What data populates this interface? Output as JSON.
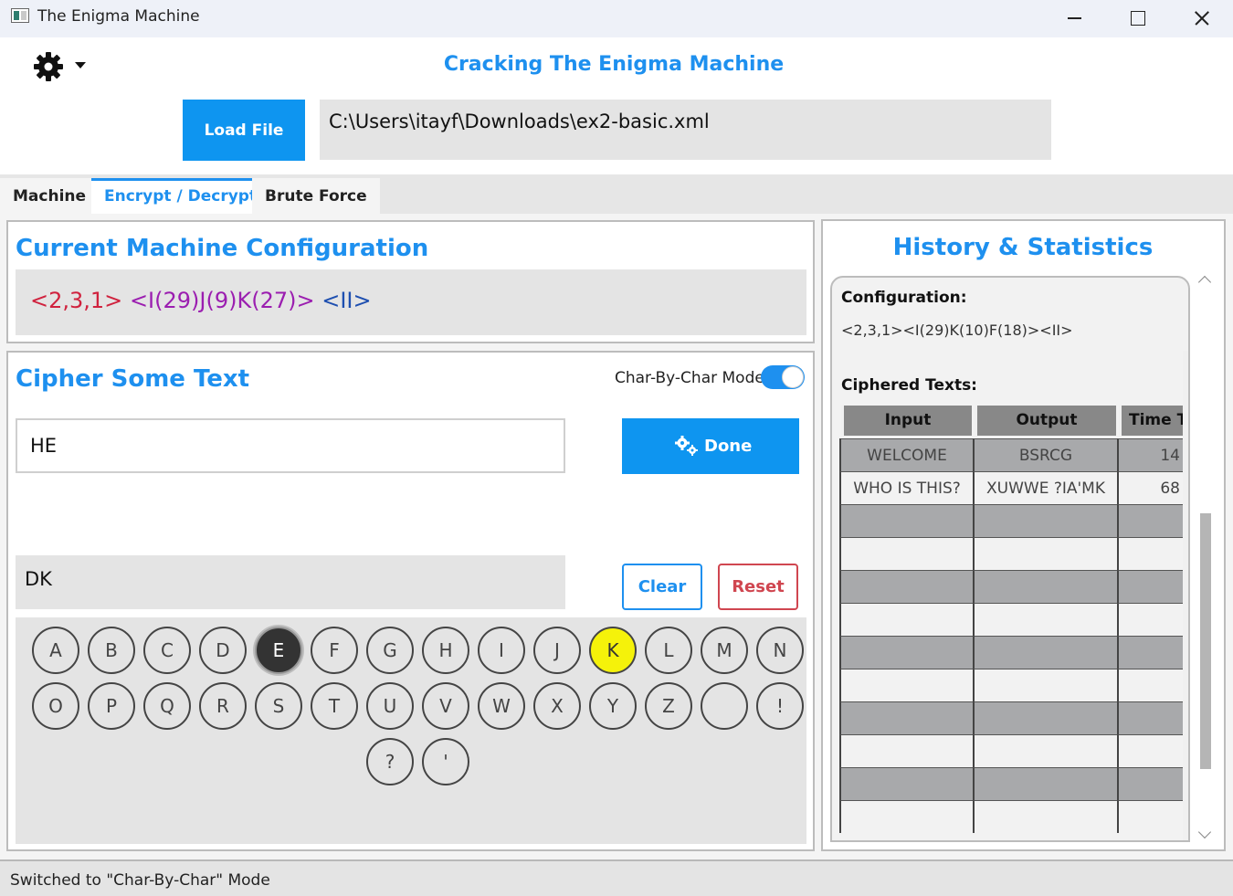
{
  "window": {
    "title": "The Enigma Machine"
  },
  "header": {
    "heading": "Cracking The Enigma Machine",
    "load_button": "Load File",
    "file_path": "C:\\Users\\itayf\\Downloads\\ex2-basic.xml"
  },
  "tabs": [
    {
      "label": "Machine",
      "active": false
    },
    {
      "label": "Encrypt / Decrypt",
      "active": true
    },
    {
      "label": "Brute Force",
      "active": false
    }
  ],
  "config_panel": {
    "title": "Current Machine Configuration",
    "rotors": "<2,3,1>",
    "positions": "<I(29)J(9)K(27)>",
    "reflector": "<II>"
  },
  "cipher_panel": {
    "title": "Cipher Some Text",
    "mode_label": "Char-By-Char Mode",
    "mode_on": true,
    "input_value": "HE",
    "done_button": "Done",
    "output_value": "DK",
    "clear_button": "Clear",
    "reset_button": "Reset"
  },
  "keyboard": {
    "rows": [
      [
        "A",
        "B",
        "C",
        "D",
        "E",
        "F",
        "G",
        "H",
        "I",
        "J",
        "K",
        "L",
        "M",
        "N"
      ],
      [
        "O",
        "P",
        "Q",
        "R",
        "S",
        "T",
        "U",
        "V",
        "W",
        "X",
        "Y",
        "Z",
        " ",
        "!"
      ],
      [
        "?",
        "'"
      ]
    ],
    "pressed_key": "E",
    "lit_key": "K"
  },
  "history": {
    "title": "History & Statistics",
    "configuration_label": "Configuration:",
    "configuration_value": "<2,3,1><I(29)K(10)F(18)><II>",
    "ciphered_label": "Ciphered Texts:",
    "columns": [
      "Input",
      "Output",
      "Time T"
    ],
    "rows": [
      [
        "WELCOME",
        "BSRCG",
        "14"
      ],
      [
        "WHO IS THIS?",
        "XUWWE ?IA'MK",
        "68"
      ]
    ]
  },
  "status": {
    "text": "Switched to \"Char-By-Char\" Mode"
  },
  "colors": {
    "accent": "#1e90ef",
    "reset": "#d04650",
    "lit_key": "#f5f20a",
    "pressed_key": "#333333"
  }
}
